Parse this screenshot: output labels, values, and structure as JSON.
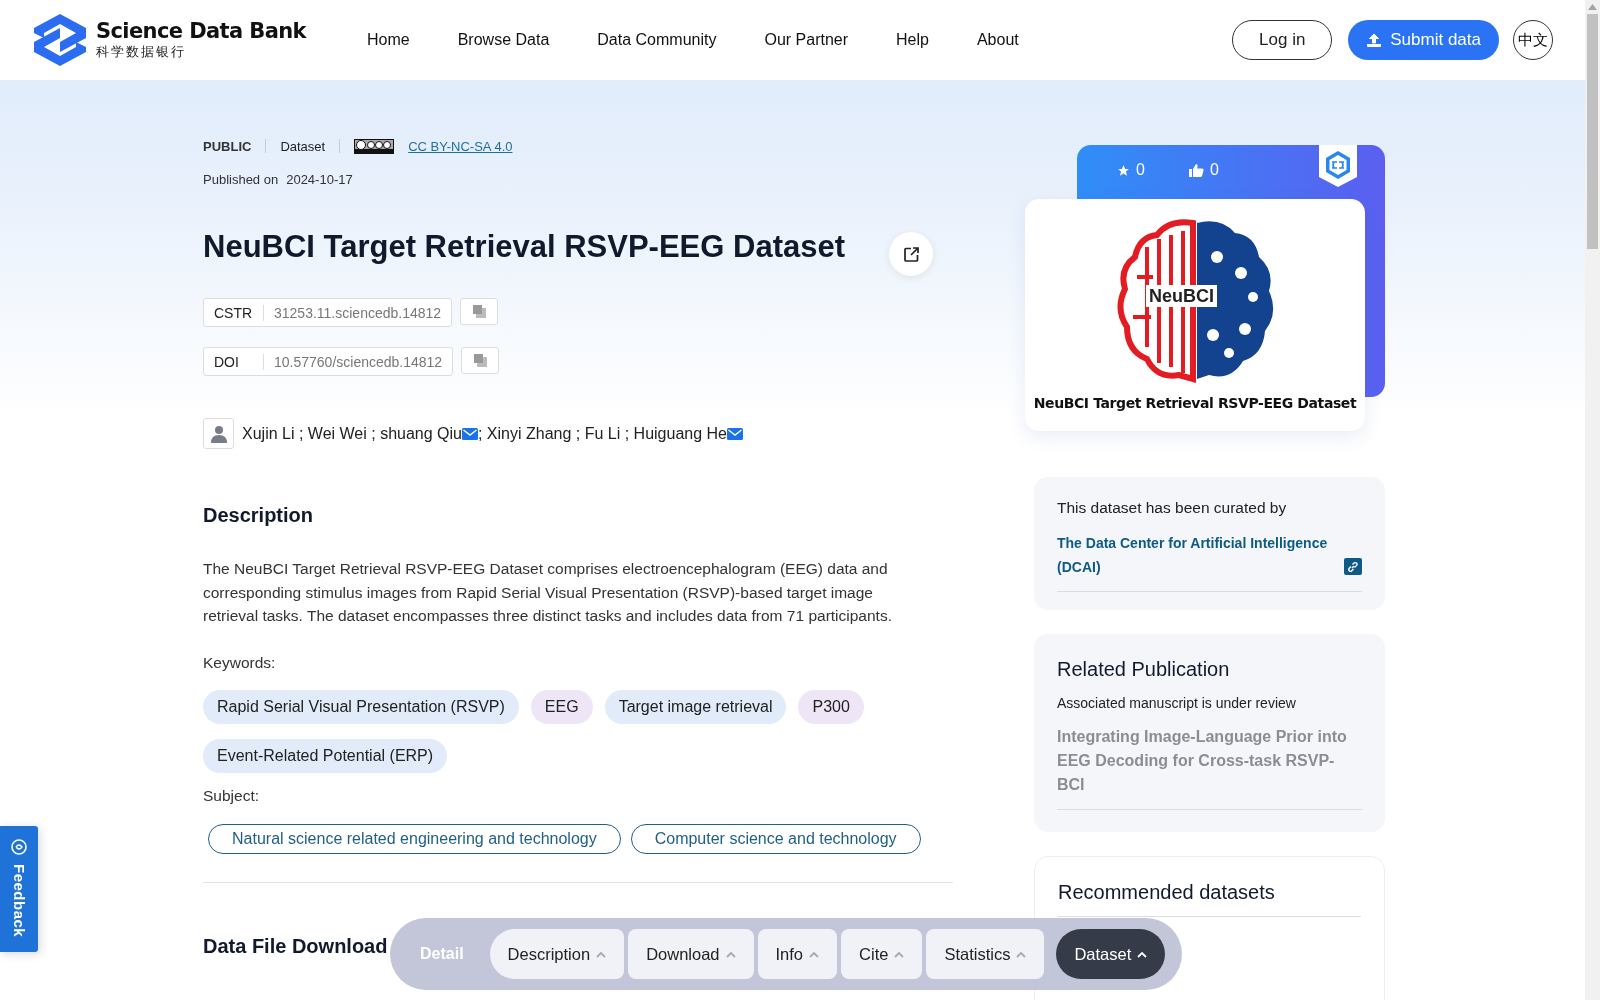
{
  "header": {
    "logo": {
      "name": "Science Data Bank",
      "subtitle": "科学数据银行"
    },
    "nav": [
      {
        "label": "Home"
      },
      {
        "label": "Browse Data"
      },
      {
        "label": "Data Community"
      },
      {
        "label": "Our Partner"
      },
      {
        "label": "Help"
      },
      {
        "label": "About"
      }
    ],
    "login": "Log in",
    "submit": "Submit data",
    "language": "中文"
  },
  "meta": {
    "access": "PUBLIC",
    "type": "Dataset",
    "license": "CC BY-NC-SA 4.0",
    "published_label": "Published on",
    "published_date": "2024-10-17"
  },
  "title": "NeuBCI Target Retrieval RSVP-EEG Dataset",
  "identifiers": [
    {
      "label": "CSTR",
      "value": "31253.11.sciencedb.14812"
    },
    {
      "label": "DOI",
      "value": "10.57760/sciencedb.14812"
    }
  ],
  "authors": [
    {
      "text": "Xujin Li ; Wei Wei ; shuang Qiu",
      "email": true
    },
    {
      "text": "; Xinyi Zhang ; Fu Li ; Huiguang He",
      "email": true
    }
  ],
  "description": {
    "heading": "Description",
    "text": "The NeuBCI Target Retrieval RSVP-EEG Dataset comprises electroencephalogram (EEG) data and corresponding stimulus images from Rapid Serial Visual Presentation (RSVP)-based target image retrieval tasks. The dataset encompasses three distinct tasks and includes data from 71 participants.",
    "keywords_label": "Keywords:",
    "keywords": [
      {
        "label": "Rapid Serial Visual Presentation (RSVP)",
        "color": "#e1ebf9"
      },
      {
        "label": "EEG",
        "color": "#eee5f6"
      },
      {
        "label": "Target image retrieval",
        "color": "#e1ebf9"
      },
      {
        "label": "P300",
        "color": "#eee5f6"
      },
      {
        "label": "Event-Related Potential (ERP)",
        "color": "#e1ebf9"
      }
    ],
    "subject_label": "Subject:",
    "subjects": [
      {
        "label": "Natural science related engineering and technology"
      },
      {
        "label": "Computer science and technology"
      }
    ]
  },
  "download_heading": "Data File Download",
  "side": {
    "stars": "0",
    "likes": "0",
    "cover_logo": "NeuBCI",
    "cover_caption": "NeuBCI Target Retrieval RSVP-EEG Dataset",
    "curated": {
      "intro": "This dataset has been curated by",
      "organization": "The Data Center for Artificial Intelligence (DCAI)"
    },
    "publication": {
      "heading": "Related Publication",
      "note": "Associated manuscript is under review",
      "title": "Integrating Image-Language Prior into EEG Decoding for Cross-task RSVP-BCI"
    },
    "recommended": {
      "heading": "Recommended datasets"
    }
  },
  "bottom_nav": {
    "label": "Detail",
    "tabs": [
      {
        "label": "Description",
        "selected": false
      },
      {
        "label": "Download",
        "selected": false
      },
      {
        "label": "Info",
        "selected": false
      },
      {
        "label": "Cite",
        "selected": false
      },
      {
        "label": "Statistics",
        "selected": false
      },
      {
        "label": "Dataset",
        "selected": true
      }
    ]
  },
  "feedback": "Feedback"
}
